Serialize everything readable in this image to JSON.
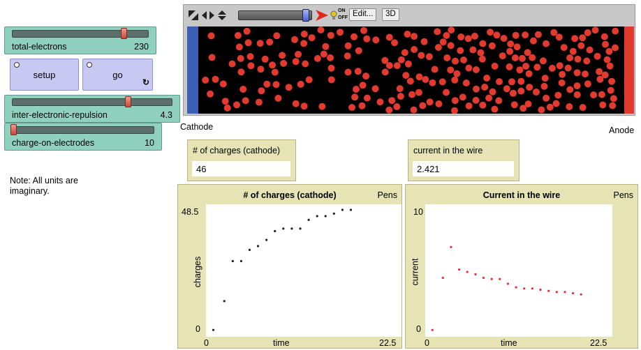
{
  "sliders": [
    {
      "label": "total-electrons",
      "value": "230",
      "fraction": 0.77
    },
    {
      "label": "inter-electronic-repulsion",
      "value": "4.3",
      "fraction": 0.72
    },
    {
      "label": "charge-on-electrodes",
      "value": "10",
      "fraction": 0.0
    }
  ],
  "buttons": {
    "setup": "setup",
    "go": "go",
    "go_forever_icon": "loop-icon"
  },
  "note": {
    "line1": "Note: All units are",
    "line2": "imaginary."
  },
  "view": {
    "toolbar": {
      "edit_label": "Edit...",
      "threed_label": "3D",
      "onoff_top": "ON",
      "onoff_bottom": "OFF"
    },
    "speed_fraction": 0.92,
    "colors": {
      "cathode": "#3a5fb5",
      "anode": "#e03a2e",
      "electron": "#e23a2e",
      "background": "#000000"
    },
    "cathode_label": "Cathode",
    "anode_label": "Anode"
  },
  "monitors": [
    {
      "label": "# of charges (cathode)",
      "value": "46"
    },
    {
      "label": "current in the wire",
      "value": "2.421"
    }
  ],
  "chart_data": [
    {
      "type": "scatter",
      "title": "# of charges (cathode)",
      "pens_label": "Pens",
      "xlabel": "time",
      "ylabel": "charges",
      "xlim": [
        0,
        22.5
      ],
      "ylim": [
        0,
        48.5
      ],
      "x_tick_labels": [
        "0",
        "22.5"
      ],
      "y_tick_labels": [
        "0",
        "48.5"
      ],
      "color": "#222222",
      "points": [
        [
          0.7,
          0.5
        ],
        [
          2.0,
          12.0
        ],
        [
          3.0,
          28.0
        ],
        [
          4.0,
          28.0
        ],
        [
          5.0,
          32.5
        ],
        [
          6.0,
          34.0
        ],
        [
          7.0,
          36.5
        ],
        [
          8.0,
          40.0
        ],
        [
          9.0,
          41.0
        ],
        [
          10.0,
          41.0
        ],
        [
          11.0,
          41.0
        ],
        [
          12.0,
          44.5
        ],
        [
          13.0,
          46.0
        ],
        [
          14.0,
          46.0
        ],
        [
          15.0,
          47.0
        ],
        [
          16.0,
          48.5
        ],
        [
          17.0,
          48.5
        ]
      ]
    },
    {
      "type": "scatter",
      "title": "Current in the wire",
      "pens_label": "Pens",
      "xlabel": "time",
      "ylabel": "current",
      "xlim": [
        0,
        22.5
      ],
      "ylim": [
        0,
        10
      ],
      "x_tick_labels": [
        "0",
        "22.5"
      ],
      "y_tick_labels": [
        "0",
        "10"
      ],
      "color": "#e0303a",
      "points": [
        [
          0.7,
          0.1
        ],
        [
          2.0,
          4.5
        ],
        [
          3.0,
          7.1
        ],
        [
          4.0,
          5.2
        ],
        [
          5.0,
          5.0
        ],
        [
          6.0,
          4.8
        ],
        [
          7.0,
          4.5
        ],
        [
          8.0,
          4.4
        ],
        [
          9.0,
          4.4
        ],
        [
          10.0,
          4.0
        ],
        [
          11.0,
          3.7
        ],
        [
          12.0,
          3.6
        ],
        [
          13.0,
          3.6
        ],
        [
          14.0,
          3.5
        ],
        [
          15.0,
          3.4
        ],
        [
          16.0,
          3.3
        ],
        [
          17.0,
          3.3
        ],
        [
          18.0,
          3.2
        ],
        [
          19.0,
          3.1
        ]
      ]
    }
  ]
}
